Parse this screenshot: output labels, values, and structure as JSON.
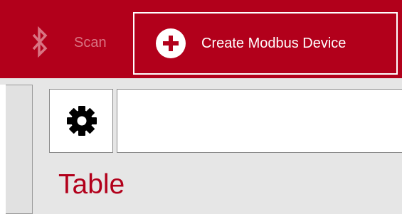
{
  "toolbar": {
    "scan": {
      "label": "Scan",
      "icon": "bluetooth-icon"
    },
    "create": {
      "label": "Create Modbus Device",
      "icon": "plus-circle-icon"
    }
  },
  "main": {
    "settings_icon": "gear-icon",
    "search": {
      "value": "",
      "placeholder": ""
    },
    "heading": "Table"
  },
  "colors": {
    "accent": "#b2001b",
    "toolbar_background": "#b2001b",
    "disabled_text": "#d97483",
    "content_background": "#e6e6e6"
  }
}
